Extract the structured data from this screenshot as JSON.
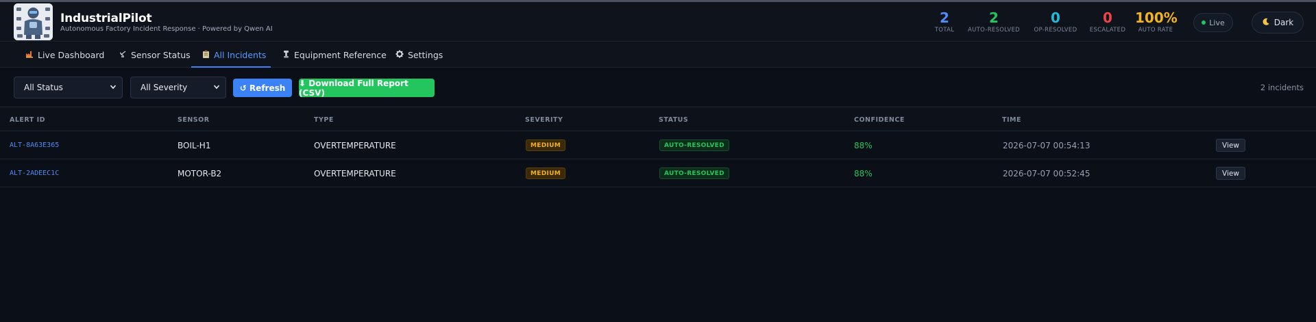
{
  "app": {
    "title": "IndustrialPilot",
    "subtitle": "Autonomous Factory Incident Response · Powered by Qwen AI"
  },
  "stats": [
    {
      "value": "2",
      "label": "TOTAL",
      "color": "#4f8cf7"
    },
    {
      "value": "2",
      "label": "AUTO-RESOLVED",
      "color": "#22c55e"
    },
    {
      "value": "0",
      "label": "OP-RESOLVED",
      "color": "#22b8d8"
    },
    {
      "value": "0",
      "label": "ESCALATED",
      "color": "#ef4444"
    },
    {
      "value": "100%",
      "label": "AUTO RATE",
      "color": "#f5b31a"
    }
  ],
  "status_pill": {
    "label": "Live",
    "icon": "live-dot"
  },
  "theme_toggle": {
    "label": "Dark",
    "icon": "moon-icon"
  },
  "tabs": [
    {
      "label": "Live Dashboard",
      "icon": "factory-icon",
      "active": false
    },
    {
      "label": "Sensor Status",
      "icon": "satellite-icon",
      "active": false
    },
    {
      "label": "All Incidents",
      "icon": "clipboard-icon",
      "active": true
    },
    {
      "label": "Equipment Reference",
      "icon": "wrench-icon",
      "active": false
    },
    {
      "label": "Settings",
      "icon": "gear-icon",
      "active": false
    }
  ],
  "filters": {
    "status": "All Status",
    "severity": "All Severity",
    "refresh_label": "↺ Refresh",
    "download_label": "⬇ Download Full Report (CSV)",
    "incident_count": "2 incidents"
  },
  "table": {
    "columns": [
      "ALERT ID",
      "SENSOR",
      "TYPE",
      "SEVERITY",
      "STATUS",
      "CONFIDENCE",
      "TIME"
    ],
    "rows": [
      {
        "alert_id": "ALT-8A63E365",
        "sensor": "BOIL-H1",
        "type": "OVERTEMPERATURE",
        "severity": "MEDIUM",
        "status": "AUTO-RESOLVED",
        "confidence": "88%",
        "time": "2026-07-07 00:54:13",
        "action": "View"
      },
      {
        "alert_id": "ALT-2ADEEC1C",
        "sensor": "MOTOR-B2",
        "type": "OVERTEMPERATURE",
        "severity": "MEDIUM",
        "status": "AUTO-RESOLVED",
        "confidence": "88%",
        "time": "2026-07-07 00:52:45",
        "action": "View"
      }
    ]
  }
}
